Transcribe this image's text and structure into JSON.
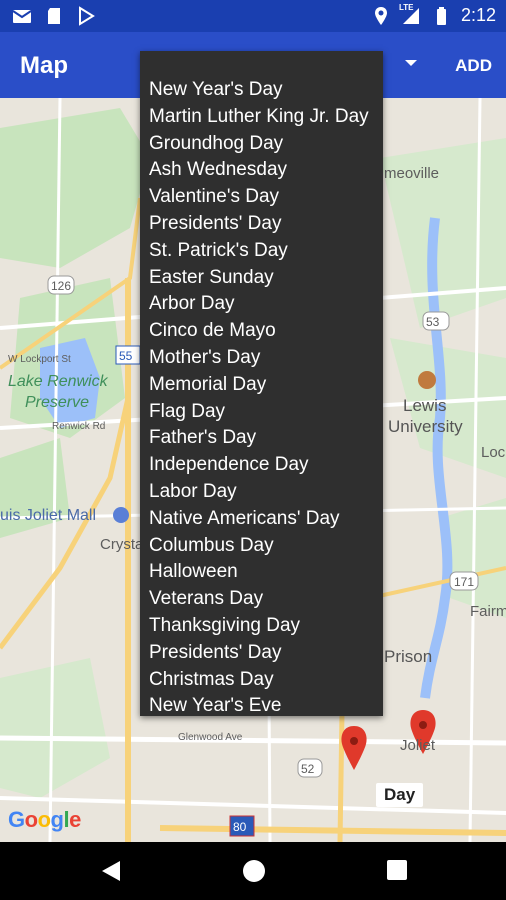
{
  "status_bar": {
    "time": "2:12",
    "icons": [
      "gmail-icon",
      "sd-card-icon",
      "play-store-icon",
      "location-icon",
      "lte-signal-icon",
      "battery-icon"
    ],
    "network": "LTE"
  },
  "app_bar": {
    "title": "Map",
    "add_label": "ADD",
    "background": "#2a4ec8"
  },
  "holiday_menu": {
    "items": [
      "New Year's Day",
      "Martin Luther King Jr. Day",
      "Groundhog Day",
      "Ash Wednesday",
      "Valentine's Day",
      "Presidents' Day",
      "St. Patrick's Day",
      "Easter Sunday",
      "Arbor Day",
      "Cinco de Mayo",
      "Mother's Day",
      "Memorial Day",
      "Flag Day",
      "Father's Day",
      "Independence Day",
      "Labor Day",
      "Native Americans' Day",
      "Columbus Day",
      "Halloween",
      "Veterans Day",
      "Thanksgiving Day",
      "Presidents' Day",
      "Christmas Day",
      "New Year's Eve"
    ]
  },
  "map": {
    "labels": {
      "lake_renwick": "Lake Renwick",
      "preserve": "Preserve",
      "lewis": "Lewis",
      "university": "University",
      "joliet_mall": "uis Joliet Mall",
      "crysta": "Crysta",
      "prison": "Prison",
      "lock": "Lock",
      "fairm": "Fairm",
      "joliet": "Joliet",
      "meoville": "meoville",
      "w_lockport_st": "W Lockport St",
      "renwick_rd": "Renwick Rd",
      "glenwood_ave": "Glenwood Ave",
      "route_126": "126",
      "route_55": "55",
      "route_53": "53",
      "route_171": "171",
      "route_52": "52",
      "route_80": "80"
    },
    "info_window_text": "Day",
    "google_logo": "Google"
  }
}
